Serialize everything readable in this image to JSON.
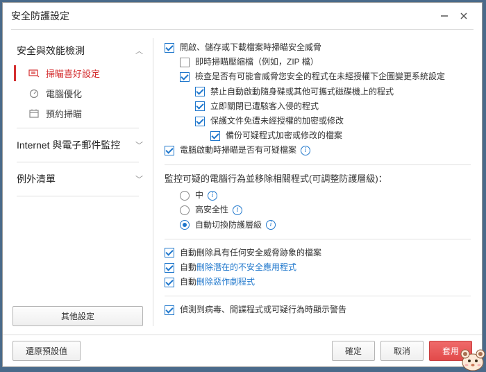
{
  "window": {
    "title": "安全防護設定"
  },
  "sidebar": {
    "section1": {
      "title": "安全與效能檢測"
    },
    "items": [
      {
        "label": "掃瞄喜好設定"
      },
      {
        "label": "電腦優化"
      },
      {
        "label": "預約掃瞄"
      }
    ],
    "section2": {
      "title": "Internet 與電子郵件監控"
    },
    "section3": {
      "title": "例外清單"
    },
    "other_button": "其他設定"
  },
  "content": {
    "c1": "開啟、儲存或下載檔案時掃瞄安全威脅",
    "c1a": "即時掃瞄壓縮檔（例如，ZIP 檔）",
    "c1b": "檢查是否有可能會威脅您安全的程式在未經授權下企圖變更系統設定",
    "c1b1": "禁止自動啟動隨身碟或其他可攜式磁碟機上的程式",
    "c1b2": "立即關閉已遭駭客入侵的程式",
    "c1b3": "保護文件免遭未經授權的加密或修改",
    "c1b3a": "備份可疑程式加密或修改的檔案",
    "c2": "電腦啟動時掃瞄是否有可疑檔案",
    "section2_title": "監控可疑的電腦行為並移除相關程式(可調整防護層級)：",
    "r1": "中",
    "r2": "高安全性",
    "r3": "自動切換防護層級",
    "c3": "自動刪除具有任何安全威脅跡象的檔案",
    "c4_prefix": "自動",
    "c4_link": "刪除潛在的不安全應用程式",
    "c5_prefix": "自動",
    "c5_link": "刪除惡作劇程式",
    "c6": "偵測到病毒、間諜程式或可疑行為時顯示警告"
  },
  "footer": {
    "restore": "還原預設值",
    "ok": "確定",
    "cancel": "取消",
    "apply": "套用"
  }
}
